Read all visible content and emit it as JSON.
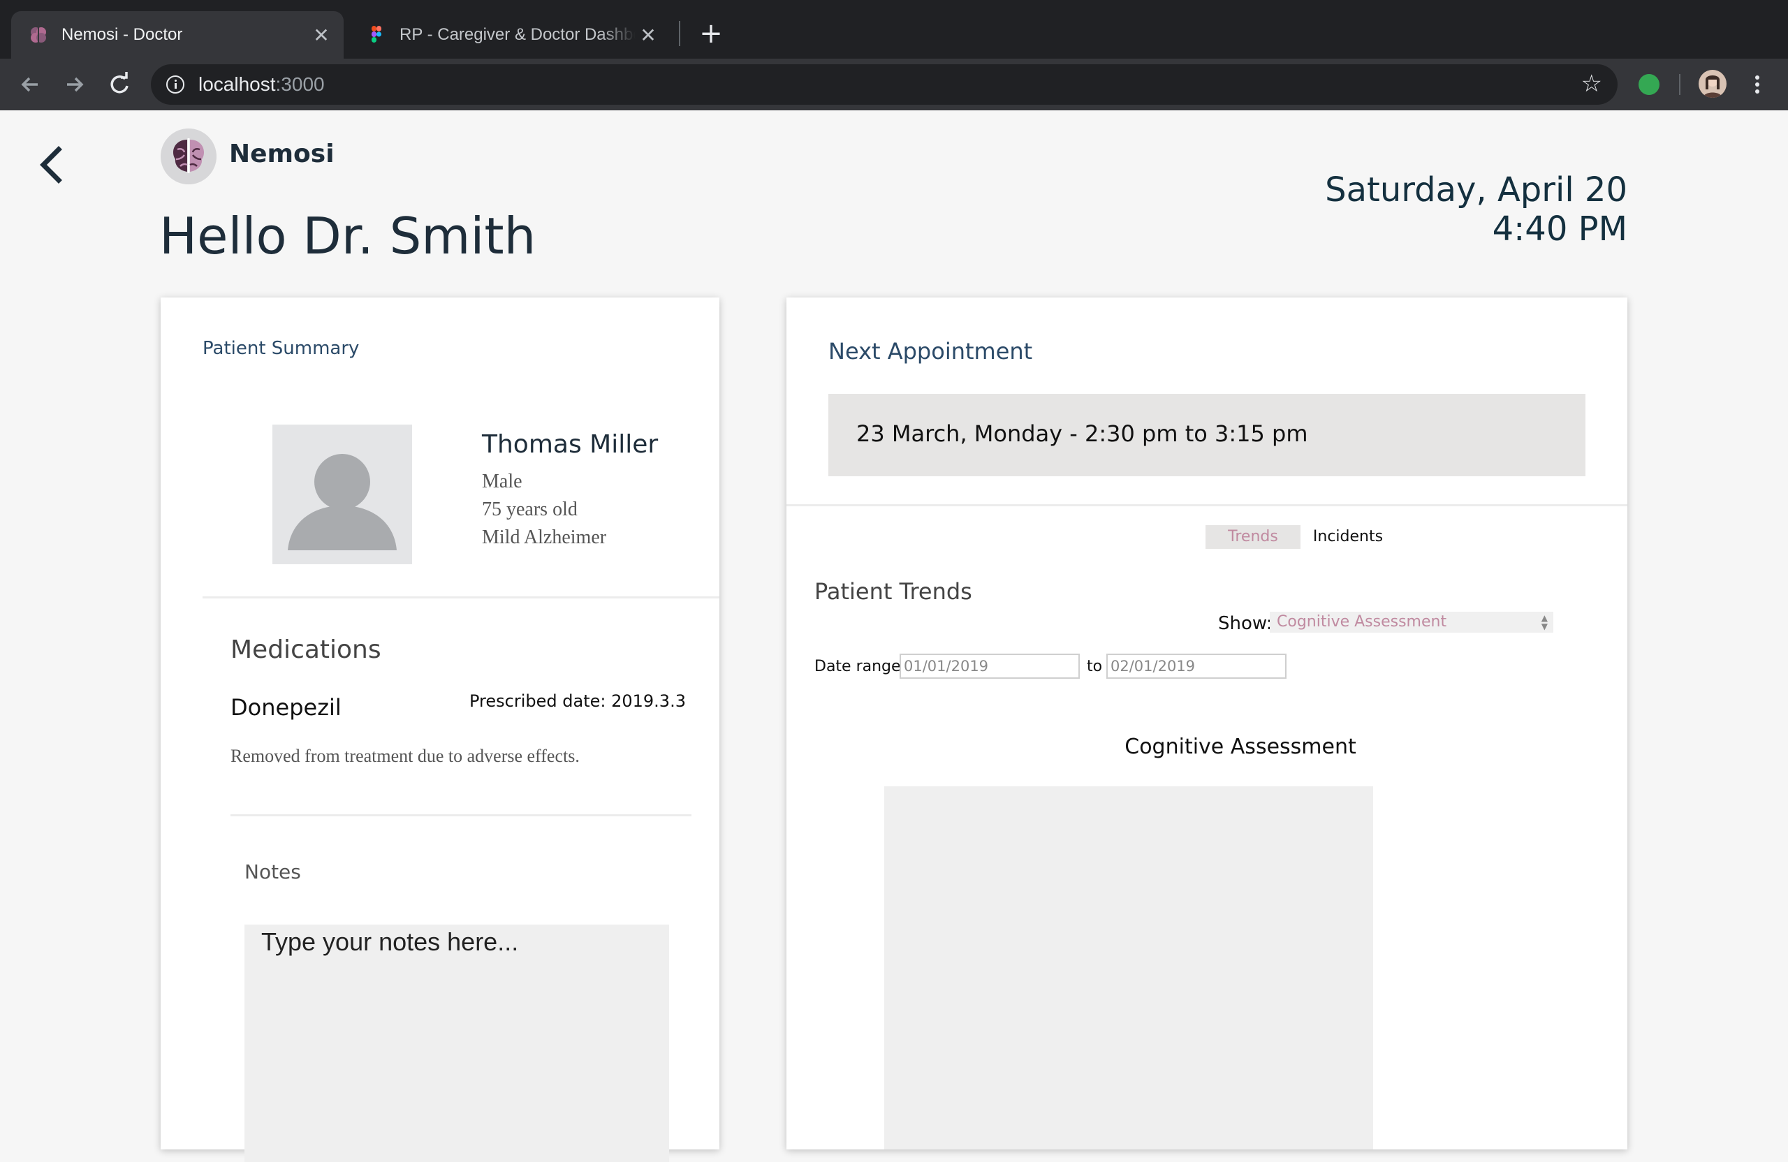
{
  "browser": {
    "tabs": [
      {
        "title": "Nemosi - Doctor",
        "active": true,
        "icon": "brain-favicon-icon"
      },
      {
        "title": "RP - Caregiver & Doctor Dashboard",
        "active": false,
        "icon": "figma-icon"
      }
    ],
    "address": {
      "host": "localhost",
      "port": ":3000"
    }
  },
  "app": {
    "brand": "Nemosi",
    "greeting": "Hello Dr. Smith",
    "date": "Saturday, April 20",
    "time": "4:40 PM"
  },
  "patient_summary": {
    "title": "Patient Summary",
    "name": "Thomas Miller",
    "gender": "Male",
    "age": "75 years old",
    "condition": "Mild Alzheimer"
  },
  "medications": {
    "heading": "Medications",
    "items": [
      {
        "name": "Donepezil",
        "prescribed": "Prescribed date: 2019.3.3",
        "note": "Removed from treatment due to adverse effects."
      }
    ]
  },
  "notes": {
    "heading": "Notes",
    "placeholder": "Type your notes here..."
  },
  "appointment": {
    "title": "Next Appointment",
    "text": "23 March, Monday - 2:30 pm to 3:15 pm"
  },
  "trends": {
    "tabs": [
      "Trends",
      "Incidents"
    ],
    "selected_tab": "Trends",
    "title": "Patient Trends",
    "show_label": "Show:",
    "show_value": "Cognitive Assessment",
    "date_range_label": "Date range:",
    "from_date": "01/01/2019",
    "to_label": "to",
    "to_date": "02/01/2019",
    "chart_title": "Cognitive Assessment"
  },
  "colors": {
    "accent_pink": "#c08aa0",
    "heading_blue": "#2b4a68",
    "dark_text": "#1e2d3a"
  }
}
